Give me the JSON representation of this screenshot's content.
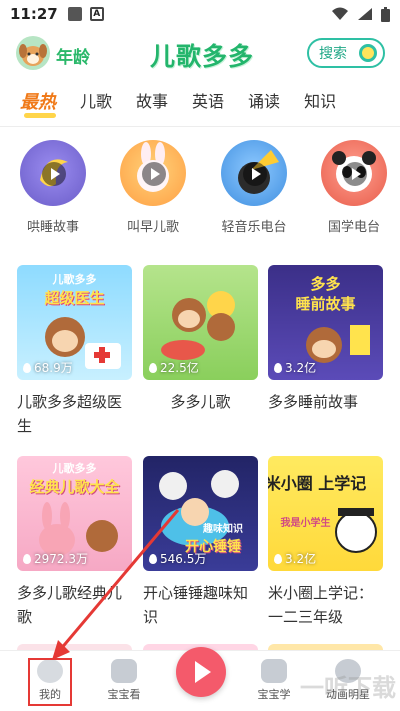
{
  "status_bar": {
    "time": "11:27",
    "a_icon": "A"
  },
  "header": {
    "age_label": "年龄",
    "logo": "儿歌多多",
    "search_label": "搜索"
  },
  "tabs": [
    {
      "label": "最热",
      "active": true
    },
    {
      "label": "儿歌",
      "active": false
    },
    {
      "label": "故事",
      "active": false
    },
    {
      "label": "英语",
      "active": false
    },
    {
      "label": "诵读",
      "active": false
    },
    {
      "label": "知识",
      "active": false
    }
  ],
  "radios": [
    {
      "label": "哄睡故事",
      "color": "#7a6bd6"
    },
    {
      "label": "叫早儿歌",
      "color": "#ffb347"
    },
    {
      "label": "轻音乐电台",
      "color": "#5aa8f0"
    },
    {
      "label": "国学电台",
      "color": "#f27b6b"
    }
  ],
  "albums": [
    {
      "title": "儿歌多多超级医生",
      "count": "68.9万",
      "cover_text": "超级医生",
      "cover_top": "儿歌多多",
      "color": "#7fd1f5"
    },
    {
      "title": "多多儿歌",
      "count": "22.5亿",
      "cover_text": "",
      "cover_top": "",
      "color": "#a4d96c"
    },
    {
      "title": "多多睡前故事",
      "count": "3.2亿",
      "cover_text": "睡前故事",
      "cover_top": "多多",
      "color": "#4f3f9e"
    },
    {
      "title": "多多儿歌经典儿歌",
      "count": "2972.3万",
      "cover_text": "经典儿歌大全",
      "cover_top": "儿歌多多",
      "color": "#f6b9cf"
    },
    {
      "title": "开心锤锤趣味知识",
      "count": "546.5万",
      "cover_text": "开心锤锤",
      "cover_top": "趣味知识",
      "color": "#2e2f7a"
    },
    {
      "title": "米小圈上学记：一二三年级",
      "count": "3.2亿",
      "cover_text": "米小圈 上学记",
      "cover_top": "我是小学生",
      "color": "#ffe34d"
    }
  ],
  "bottom_nav": [
    {
      "label": "我的"
    },
    {
      "label": "宝宝看"
    },
    {
      "label": "宝宝学"
    },
    {
      "label": "动画明星"
    }
  ],
  "watermark": "一听下载",
  "colors": {
    "accent_green": "#23b56c",
    "accent_orange": "#f07a19",
    "play_red": "#f45a6b",
    "highlight_red": "#e53935"
  }
}
